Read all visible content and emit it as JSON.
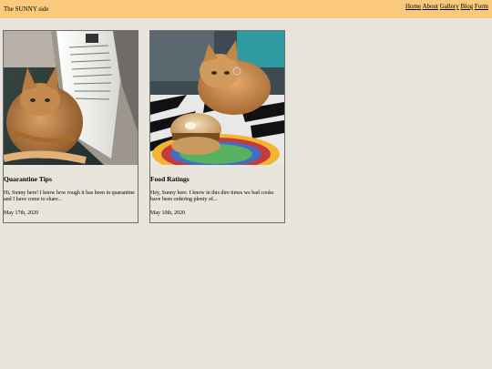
{
  "site": {
    "brand": "The SUNNY side"
  },
  "nav": {
    "items": [
      "Home",
      "About",
      "Gallery",
      "Blog",
      "Form"
    ]
  },
  "posts": [
    {
      "title": "Quarantine Tips",
      "excerpt": "Hi, Sunny here! I know how rough it has been in quarantine and I have come to share...",
      "date": "May 17th, 2020",
      "image": "orange-cat-reading-book"
    },
    {
      "title": "Food Ratings",
      "excerpt": "Hey, Sunny here. I know in this dire times we bad cooks have been ordering plenty of...",
      "date": "May 10th, 2020",
      "image": "orange-cat-with-sandwich"
    }
  ],
  "colors": {
    "header": "#fbc97b",
    "background": "#e8e6dc",
    "card_border": "#6d6d6d"
  }
}
